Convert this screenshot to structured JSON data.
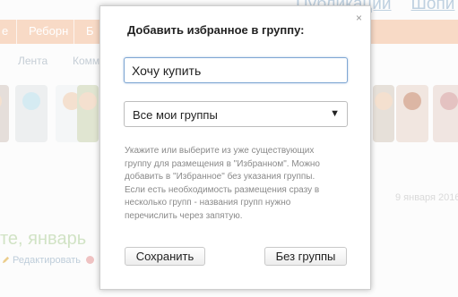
{
  "background": {
    "top_links": [
      "Публикации",
      "Шопи"
    ],
    "nav_items": [
      "е",
      "Реборн",
      "Б"
    ],
    "sub_nav": [
      "Лента",
      "Комм"
    ],
    "date": "9 января 2016",
    "post_title": "те, январь",
    "edit_label": "Редактировать"
  },
  "dialog": {
    "title": "Добавить избранное в группу:",
    "close_icon": "×",
    "input_value": "Хочу купить",
    "select_value": "Все мои группы",
    "select_arrow": "▼",
    "help_lines": [
      "Укажите или выберите из уже существующих",
      "группу для размещения в \"Избранном\". Можно",
      "добавить в \"Избранное\" без указания группы.",
      "Если есть необходимость размещения сразу в",
      "несколько групп - названия групп нужно",
      "перечислить через запятую."
    ],
    "save_label": "Сохранить",
    "nogroup_label": "Без группы"
  },
  "colors": {
    "nav_bar": "#f5c7a8",
    "link": "#9bb7cf",
    "green_title": "#b9d4a6",
    "input_border": "#7fa7d3"
  }
}
